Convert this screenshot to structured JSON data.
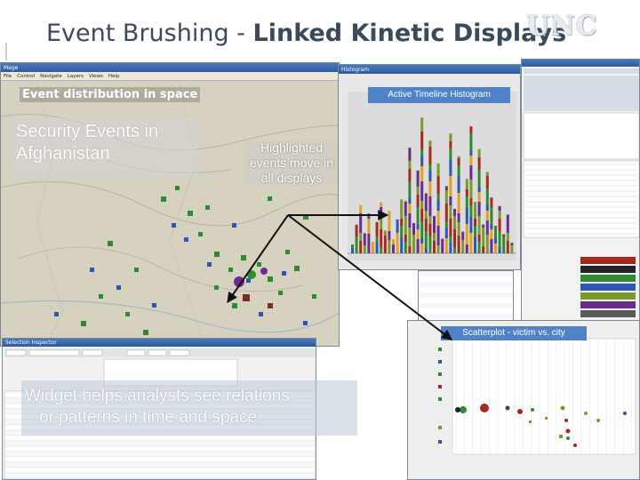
{
  "slide": {
    "title_plain": "Event Brushing -",
    "title_bold": "Linked Kinetic Displays",
    "logo_text": "UNC"
  },
  "map_window": {
    "title": "Mage",
    "menu": [
      "File",
      "Control",
      "Navigate",
      "Layers",
      "Views",
      "Help"
    ],
    "label_event_space": "Event distribution in space",
    "label_security": "Security Events in Afghanistan",
    "label_highlighted": "Highlighted events move in all displays"
  },
  "histogram_window": {
    "title": "Histogram",
    "label": "Active Timeline Histogram"
  },
  "scatter_window": {
    "label": "Scatterplot - victim vs. city"
  },
  "table_window": {
    "title": "Selection Inspector"
  },
  "overlay": {
    "line1": "Widget helps analysts see relations",
    "line2": "or patterns in time and space"
  },
  "colors": {
    "accent_blue": "#4f82c8",
    "highlight_green": "#2e8b2e",
    "highlight_purple": "#6a2c91",
    "title_text": "#3a4a5a"
  }
}
